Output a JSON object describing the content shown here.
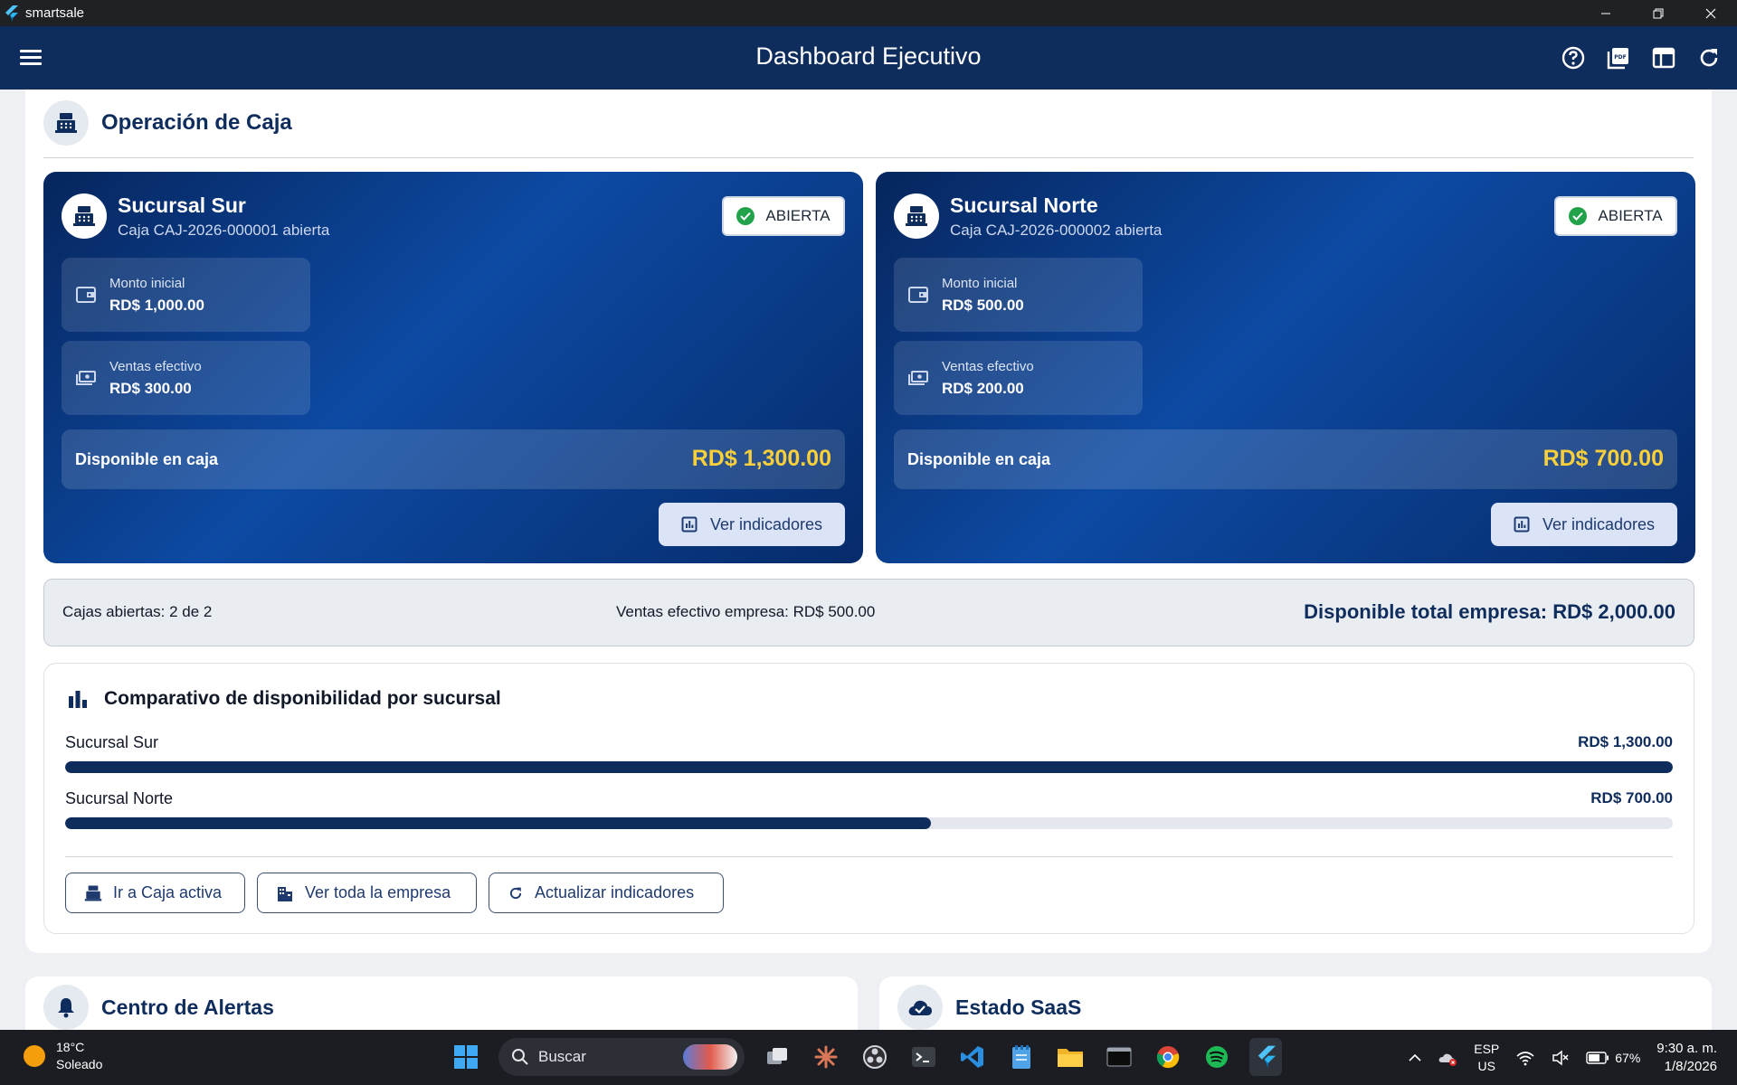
{
  "window": {
    "app_name": "smartsale"
  },
  "appbar": {
    "title": "Dashboard Ejecutivo"
  },
  "section": {
    "title": "Operación de Caja"
  },
  "branches": [
    {
      "name": "Sucursal Sur",
      "subtitle": "Caja CAJ-2026-000001 abierta",
      "status": "ABIERTA",
      "monto_label": "Monto inicial",
      "monto_value": "RD$ 1,000.00",
      "ventas_label": "Ventas efectivo",
      "ventas_value": "RD$ 300.00",
      "disponible_label": "Disponible en caja",
      "disponible_value": "RD$ 1,300.00",
      "button": "Ver indicadores"
    },
    {
      "name": "Sucursal Norte",
      "subtitle": "Caja CAJ-2026-000002 abierta",
      "status": "ABIERTA",
      "monto_label": "Monto inicial",
      "monto_value": "RD$ 500.00",
      "ventas_label": "Ventas efectivo",
      "ventas_value": "RD$ 200.00",
      "disponible_label": "Disponible en caja",
      "disponible_value": "RD$ 700.00",
      "button": "Ver indicadores"
    }
  ],
  "summary": {
    "cajas": "Cajas abiertas: 2 de 2",
    "ventas": "Ventas efectivo empresa: RD$ 500.00",
    "total": "Disponible total empresa: RD$ 2,000.00"
  },
  "comparativo": {
    "title": "Comparativo de disponibilidad por sucursal",
    "rows": [
      {
        "name": "Sucursal Sur",
        "value_label": "RD$ 1,300.00",
        "value": 1300
      },
      {
        "name": "Sucursal Norte",
        "value_label": "RD$ 700.00",
        "value": 700
      }
    ],
    "max": 1300,
    "buttons": {
      "caja": "Ir a Caja activa",
      "empresa": "Ver toda la empresa",
      "actualizar": "Actualizar indicadores"
    }
  },
  "lower": {
    "alertas": "Centro de Alertas",
    "saas": "Estado SaaS"
  },
  "taskbar": {
    "temp": "18°C",
    "weather": "Soleado",
    "search": "Buscar",
    "lang1": "ESP",
    "lang2": "US",
    "battery": "67%",
    "time": "9:30 a. m.",
    "date": "1/8/2026"
  },
  "colors": {
    "primary": "#0f2d5c",
    "accent": "#f9cf3a",
    "success": "#22a24a"
  }
}
